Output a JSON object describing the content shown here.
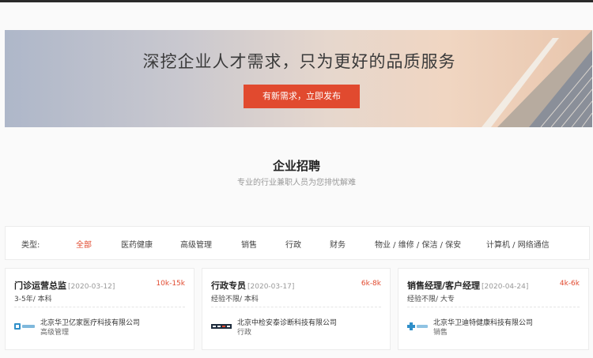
{
  "banner": {
    "title": "深挖企业人才需求，只为更好的品质服务",
    "button": "有新需求，立即发布"
  },
  "section": {
    "title": "企业招聘",
    "subtitle": "专业的行业兼职人员为您排忧解难"
  },
  "filter": {
    "label": "类型:",
    "options": [
      "全部",
      "医药健康",
      "高级管理",
      "销售",
      "行政",
      "财务",
      "物业 / 维修 / 保洁 / 保安",
      "计算机 / 网络通信"
    ],
    "selected": "全部"
  },
  "jobs": [
    {
      "title": "门诊运营总监",
      "date": "[2020-03-12]",
      "salary": "10k-15k",
      "req": "3-5年/ 本科",
      "company": "北京华卫亿家医疗科技有限公司",
      "industry": "高级管理",
      "logo": "hospital-logo"
    },
    {
      "title": "行政专员",
      "date": "[2020-03-17]",
      "salary": "6k-8k",
      "req": "经验不限/ 本科",
      "company": "北京中检安泰诊断科技有限公司",
      "industry": "行政",
      "logo": "antai-logo"
    },
    {
      "title": "销售经理/客户经理",
      "date": "[2020-04-24]",
      "salary": "4k-6k",
      "req": "经验不限/ 大专",
      "company": "北京华卫迪特健康科技有限公司",
      "industry": "销售",
      "logo": "cross-logo"
    }
  ],
  "colors": {
    "accent": "#e14a2f"
  }
}
